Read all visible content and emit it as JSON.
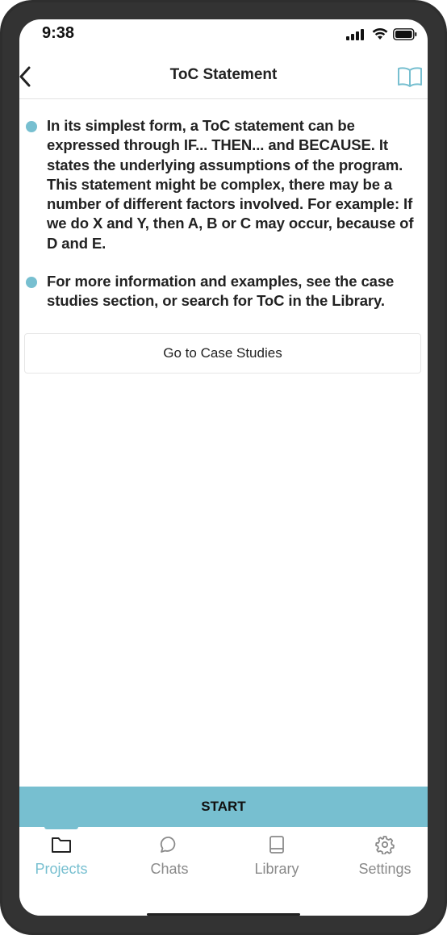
{
  "status_bar": {
    "time": "9:38"
  },
  "header": {
    "title": "ToC Statement",
    "back_icon": "chevron-left-icon",
    "library_icon": "book-open-icon"
  },
  "content": {
    "bullets": [
      "In its simplest form, a ToC statement can be expressed through IF... THEN... and BECAUSE. It states the underlying assumptions of the program. This statement might be complex, there may be a number of different factors involved. For example: If we do X and Y, then A, B or C may occur, because of D and E.",
      "For more information and examples, see the case studies section, or search for ToC in the Library."
    ],
    "case_studies_button": "Go to Case Studies"
  },
  "start_button": "START",
  "tabbar": {
    "tabs": [
      {
        "label": "Projects",
        "icon": "folder-icon",
        "active": true
      },
      {
        "label": "Chats",
        "icon": "chat-bubble-icon",
        "active": false
      },
      {
        "label": "Library",
        "icon": "book-icon",
        "active": false
      },
      {
        "label": "Settings",
        "icon": "gear-icon",
        "active": false
      }
    ]
  },
  "colors": {
    "accent": "#77bfd0",
    "text": "#222222",
    "muted": "#8a8a8a"
  }
}
